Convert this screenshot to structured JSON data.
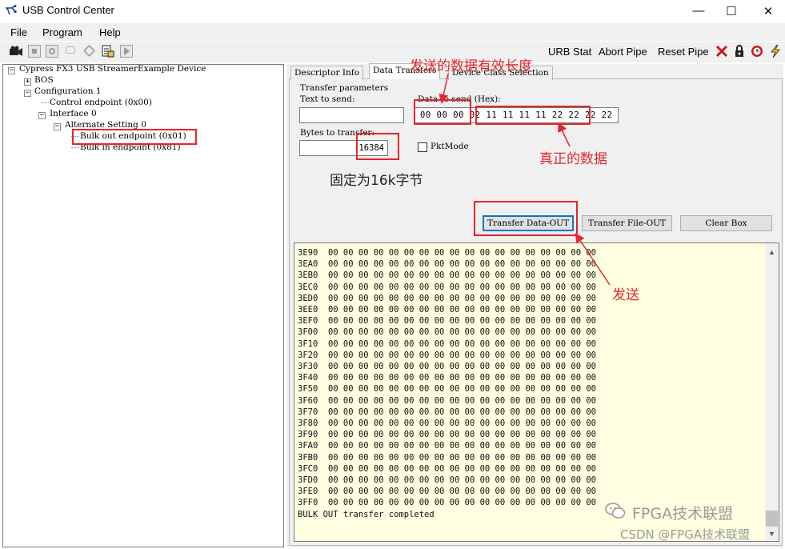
{
  "window": {
    "title": "USB Control Center",
    "controls": {
      "minimize": "—",
      "maximize": "☐",
      "close": "✕"
    }
  },
  "menu": {
    "items": [
      "File",
      "Program",
      "Help"
    ]
  },
  "toolbar": {
    "icons": [
      "camera-icon",
      "stop-icon",
      "refresh-icon",
      "message-icon",
      "tool-icon",
      "open-file-icon",
      "play-icon"
    ],
    "urb_stat": "URB Stat",
    "abort_pipe": "Abort Pipe",
    "reset_pipe": "Reset Pipe",
    "right_icons": [
      "red-x-icon",
      "lock-icon",
      "clock-icon",
      "lightning-icon"
    ]
  },
  "tree": {
    "items": [
      {
        "label": "Cypress FX3 USB StreamerExample Device",
        "expander": "−"
      },
      {
        "label": "BOS",
        "expander": "+"
      },
      {
        "label": "Configuration 1",
        "expander": "−"
      },
      {
        "label": "Control endpoint (0x00)",
        "expander": ""
      },
      {
        "label": "Interface 0",
        "expander": "−"
      },
      {
        "label": "Alternate Setting 0",
        "expander": "−"
      },
      {
        "label": "Bulk out endpoint (0x01)",
        "expander": ""
      },
      {
        "label": "Bulk in endpoint (0x81)",
        "expander": ""
      }
    ]
  },
  "tabs": [
    "Descriptor Info",
    "Data Transfers",
    "Device Class Selection"
  ],
  "transfer": {
    "params_label": "Transfer parameters",
    "text_to_send_label": "Text to send:",
    "text_to_send_value": "",
    "data_to_send_label": "Data to send (Hex):",
    "data_to_send_value": "00 00 00 02 11 11 11 11 22 22 22 22",
    "bytes_label": "Bytes to transfer:",
    "bytes_value": "16384",
    "pktmode_label": "PktMode",
    "pktmode_checked": false,
    "buttons": {
      "transfer_data_out": "Transfer Data-OUT",
      "transfer_file_out": "Transfer File-OUT",
      "clear_box": "Clear Box"
    }
  },
  "output": {
    "addresses": [
      "3E90",
      "3EA0",
      "3EB0",
      "3EC0",
      "3ED0",
      "3EE0",
      "3EF0",
      "3F00",
      "3F10",
      "3F20",
      "3F30",
      "3F40",
      "3F50",
      "3F60",
      "3F70",
      "3F80",
      "3F90",
      "3FA0",
      "3FB0",
      "3FC0",
      "3FD0",
      "3FE0",
      "3FF0"
    ],
    "row_bytes": "00 00 00 00 00 00 00 00 00 00 00 00 00 00 00 00 00 00",
    "status": "BULK OUT transfer completed"
  },
  "annotations": {
    "valid_length": "发送的数据有效长度",
    "real_data": "真正的数据",
    "fixed_16k": "固定为16k字节",
    "send": "发送",
    "color": "#e5262a"
  },
  "watermark": {
    "wechat": "FPGA技术联盟",
    "csdn": "CSDN @FPGA技术联盟"
  }
}
